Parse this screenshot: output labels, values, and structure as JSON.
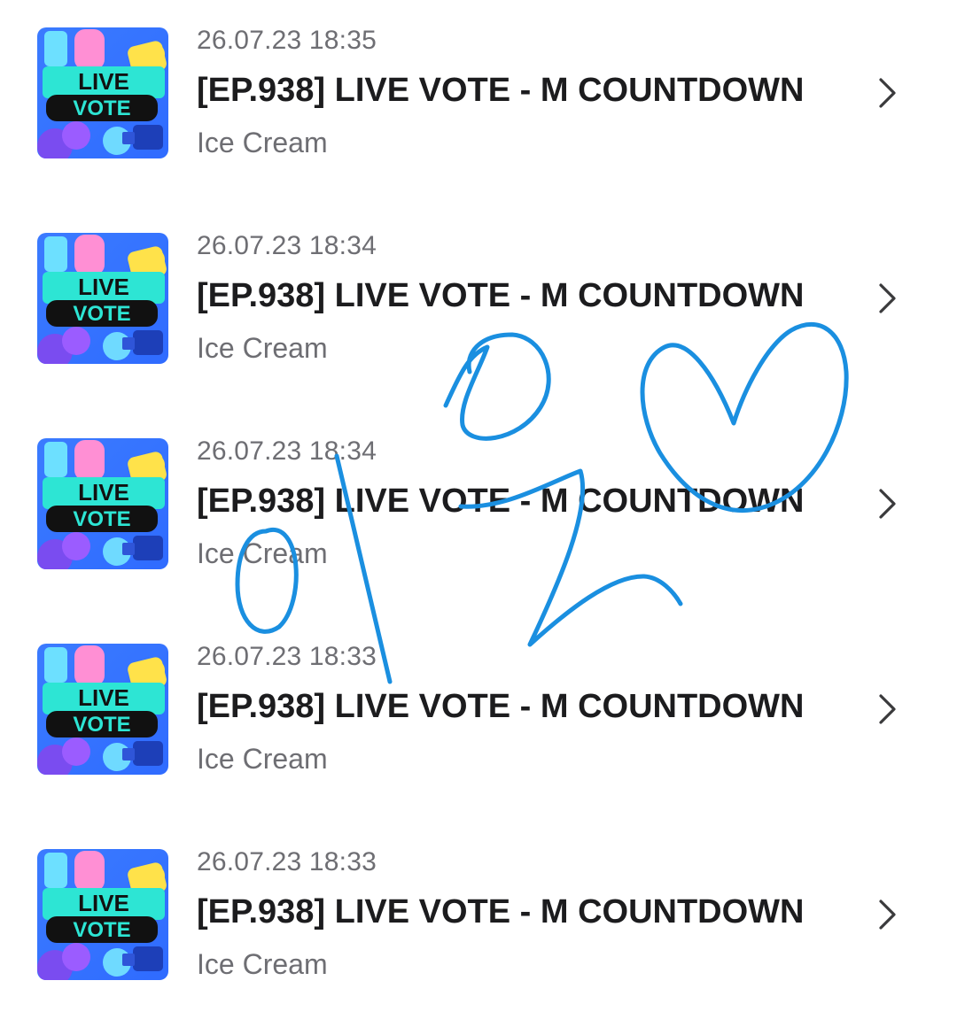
{
  "list": {
    "items": [
      {
        "date": "26.07.23 18:35",
        "title": "[EP.938] LIVE VOTE - M COUNTDOWN",
        "artist": "Ice Cream",
        "thumbnail_icon": "live-vote-thumbnail",
        "thumbnail_text": [
          "LIVE",
          "VOTE"
        ]
      },
      {
        "date": "26.07.23 18:34",
        "title": "[EP.938] LIVE VOTE - M COUNTDOWN",
        "artist": "Ice Cream",
        "thumbnail_icon": "live-vote-thumbnail",
        "thumbnail_text": [
          "LIVE",
          "VOTE"
        ]
      },
      {
        "date": "26.07.23 18:34",
        "title": "[EP.938] LIVE VOTE - M COUNTDOWN",
        "artist": "Ice Cream",
        "thumbnail_icon": "live-vote-thumbnail",
        "thumbnail_text": [
          "LIVE",
          "VOTE"
        ]
      },
      {
        "date": "26.07.23 18:33",
        "title": "[EP.938] LIVE VOTE - M COUNTDOWN",
        "artist": "Ice Cream",
        "thumbnail_icon": "live-vote-thumbnail",
        "thumbnail_text": [
          "LIVE",
          "VOTE"
        ]
      },
      {
        "date": "26.07.23 18:33",
        "title": "[EP.938] LIVE VOTE - M COUNTDOWN",
        "artist": "Ice Cream",
        "thumbnail_icon": "live-vote-thumbnail",
        "thumbnail_text": [
          "LIVE",
          "VOTE"
        ]
      }
    ]
  },
  "icons": {
    "row_action": "chevron-right-icon"
  },
  "colors": {
    "title": "#1c1c1e",
    "secondary_text": "#6e6e73",
    "chevron": "#3a3a3c",
    "doodle_stroke": "#1a8fe0",
    "thumb_teal": "#2de5d4",
    "thumb_blue": "#2f6bff",
    "thumb_black_band": "#111111"
  }
}
